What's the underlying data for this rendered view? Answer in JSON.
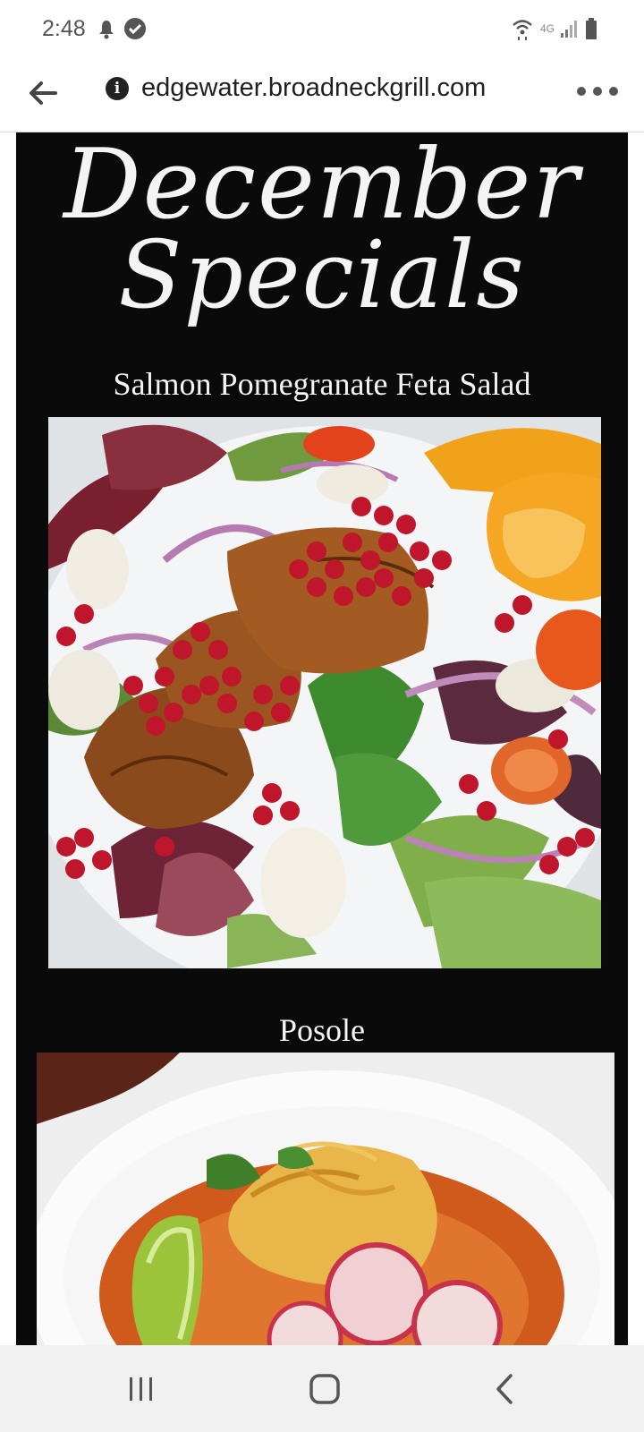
{
  "status_bar": {
    "time": "2:48",
    "left_icons": [
      "notification-bell-icon",
      "check-circle-icon"
    ],
    "right_icons": [
      "wifi-icon",
      "4g-icon",
      "signal-icon",
      "battery-icon"
    ],
    "network_label": "4G"
  },
  "browser": {
    "url": "edgewater.broadneckgrill.com",
    "back_icon": "arrow-left-icon",
    "info_icon": "info-icon",
    "info_glyph": "i",
    "more_icon": "more-dots-icon"
  },
  "page": {
    "heading_line1": "December",
    "heading_line2": "Specials",
    "items": [
      {
        "name": "Salmon Pomegranate Feta Salad",
        "image": "salmon-salad-photo"
      },
      {
        "name": "Posole",
        "image": "posole-photo"
      }
    ]
  },
  "nav_bar": {
    "buttons": [
      "recent-apps-icon",
      "home-icon",
      "back-icon"
    ]
  },
  "colors": {
    "panel_bg": "#0a0a0a",
    "title_text": "#f4f4f4",
    "pomegranate": "#c0162b",
    "nav_bg": "#f1f1f1"
  }
}
